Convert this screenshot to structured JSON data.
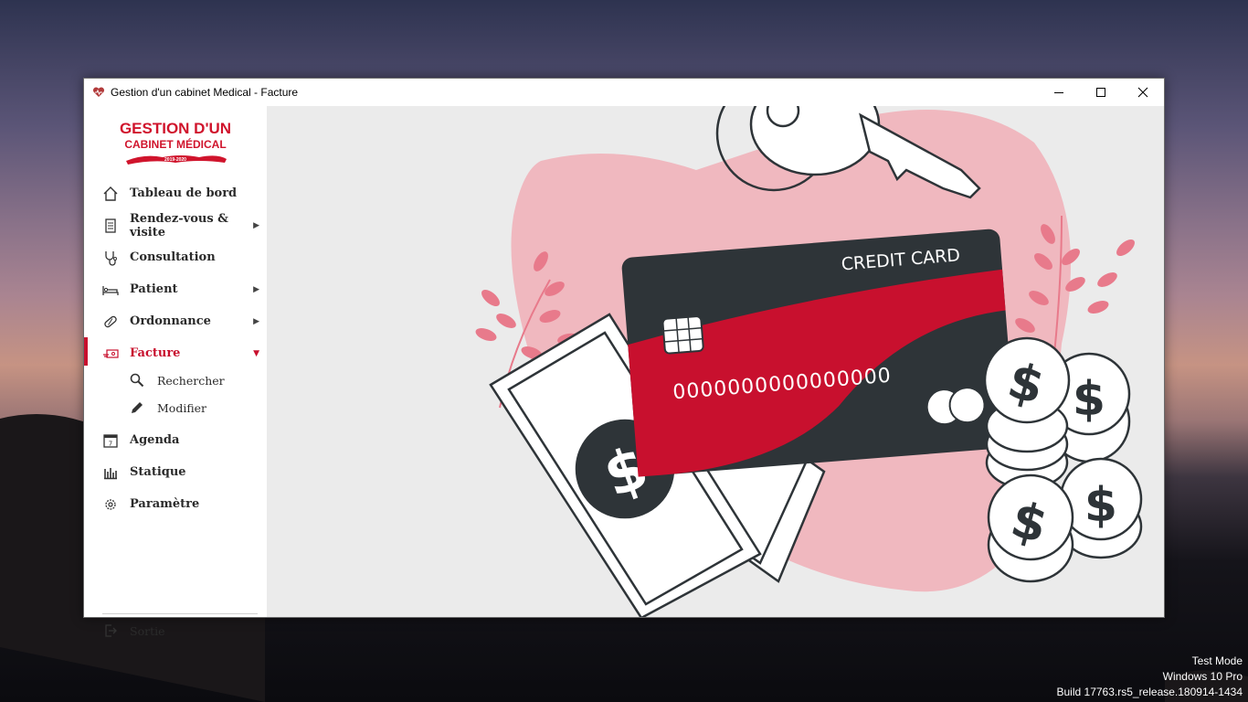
{
  "window": {
    "title": "Gestion d'un cabinet Medical - Facture"
  },
  "logo": {
    "line1": "GESTION D'UN",
    "line2": "CABINET MÉDICAL",
    "years": "2019-2020"
  },
  "sidebar": {
    "items": [
      {
        "label": "Tableau de bord",
        "icon": "home-icon",
        "arrow": ""
      },
      {
        "label": "Rendez-vous & visite",
        "icon": "document-icon",
        "arrow": "▶"
      },
      {
        "label": "Consultation",
        "icon": "stethoscope-icon",
        "arrow": ""
      },
      {
        "label": "Patient",
        "icon": "bed-icon",
        "arrow": "▶"
      },
      {
        "label": "Ordonnance",
        "icon": "pill-icon",
        "arrow": "▶"
      },
      {
        "label": "Facture",
        "icon": "payment-icon",
        "arrow": "▼"
      },
      {
        "label": "Agenda",
        "icon": "calendar-icon",
        "arrow": ""
      },
      {
        "label": "Statique",
        "icon": "bar-chart-icon",
        "arrow": ""
      },
      {
        "label": "Paramètre",
        "icon": "gear-icon",
        "arrow": ""
      }
    ],
    "sub_items": [
      {
        "label": "Rechercher",
        "icon": "search-icon"
      },
      {
        "label": "Modifier",
        "icon": "pencil-icon"
      }
    ],
    "exit_label": "Sortie",
    "active_color": "#c8102e"
  },
  "illustration": {
    "card_label": "CREDIT CARD",
    "card_number": "0000000000000000"
  },
  "os_watermark": {
    "line1": "Test Mode",
    "line2": "Windows 10 Pro",
    "line3": "Build 17763.rs5_release.180914-1434"
  }
}
